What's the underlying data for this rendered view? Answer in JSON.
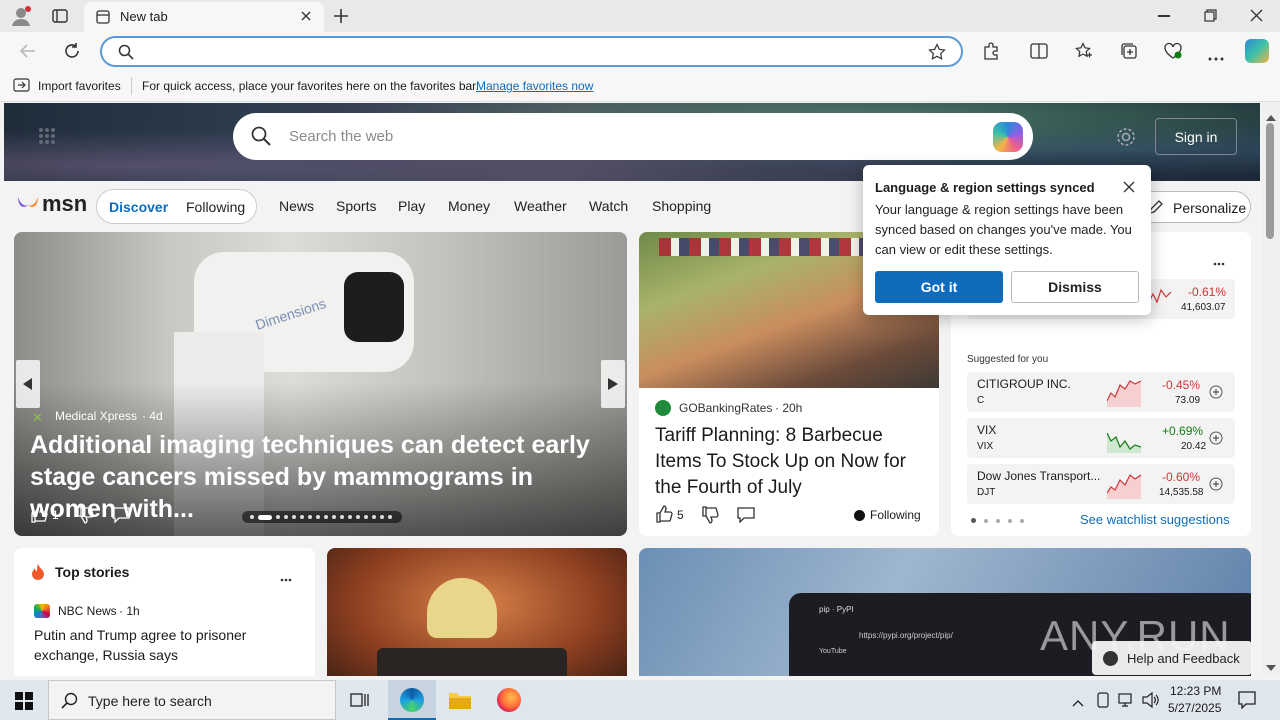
{
  "browser": {
    "tab_title": "New tab",
    "favbar": {
      "import_label": "Import favorites",
      "hint": "For quick access, place your favorites here on the favorites bar.",
      "manage_link": "Manage favorites now"
    }
  },
  "page": {
    "search_placeholder": "Search the web",
    "sign_in": "Sign in",
    "logo_text": "msn",
    "nav": {
      "discover": "Discover",
      "following": "Following",
      "items": [
        "News",
        "Sports",
        "Play",
        "Money",
        "Weather",
        "Watch",
        "Shopping"
      ],
      "personalize": "Personalize"
    },
    "popup": {
      "title": "Language & region settings synced",
      "body": "Your language & region settings have been synced based on changes you've made. You can view or edit these settings.",
      "got_it": "Got it",
      "dismiss": "Dismiss"
    },
    "featured": {
      "source": "Medical Xpress",
      "age": "· 4d",
      "headline": "Additional imaging techniques can detect early stage cancers missed by mammograms in women with...",
      "likes": "1",
      "machine_label": "Dimensions"
    },
    "article2": {
      "source": "GOBankingRates",
      "age": "· 20h",
      "headline": "Tariff Planning: 8 Barbecue Items To Stock Up on Now for the Fourth of July",
      "likes": "5",
      "following": "Following"
    },
    "watchlist": {
      "top_item": {
        "change": "-0.61%",
        "price": "41,603.07"
      },
      "suggested_label": "Suggested for you",
      "items": [
        {
          "name": "CITIGROUP INC.",
          "ticker": "C",
          "change": "-0.45%",
          "price": "73.09",
          "color": "#d13438"
        },
        {
          "name": "VIX",
          "ticker": "VIX",
          "change": "+0.69%",
          "price": "20.42",
          "color": "#107c10"
        },
        {
          "name": "Dow Jones Transport...",
          "ticker": "DJT",
          "change": "-0.60%",
          "price": "14,535.58",
          "color": "#d13438"
        }
      ],
      "see_suggestions": "See watchlist suggestions"
    },
    "top_stories": {
      "title": "Top stories",
      "source": "NBC News",
      "age": "· 1h",
      "headline": "Putin and Trump agree to prisoner exchange, Russia says"
    },
    "screen_thumb": {
      "url_text": "https://pypi.org/project/pip/",
      "tab_text": "pip · PyPI",
      "yt": "YouTube"
    },
    "help_feedback": "Help and Feedback",
    "watermark": "ANY.RUN"
  },
  "taskbar": {
    "search_placeholder": "Type here to search",
    "time": "12:23 PM",
    "date": "5/27/2025"
  },
  "colors": {
    "accent": "#0f6cbd",
    "link": "#0f6cbd",
    "negative": "#d13438",
    "positive": "#107c10"
  }
}
